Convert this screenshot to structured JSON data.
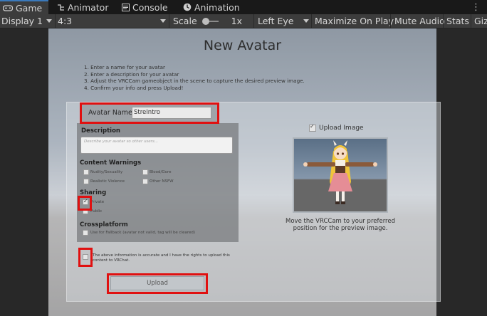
{
  "tabs": [
    {
      "label": "Game",
      "icon": "gamepad-icon",
      "active": true
    },
    {
      "label": "Animator",
      "icon": "animator-icon",
      "active": false
    },
    {
      "label": "Console",
      "icon": "console-icon",
      "active": false
    },
    {
      "label": "Animation",
      "icon": "animation-clock-icon",
      "active": false
    }
  ],
  "toolbar": {
    "display": "Display 1",
    "aspect": "4:3",
    "scale_label": "Scale",
    "scale_value": "1x",
    "eye": "Left Eye",
    "maximize": "Maximize On Play",
    "mute": "Mute Audio",
    "stats": "Stats",
    "gizmos": "Giz"
  },
  "avatar_form": {
    "title": "New Avatar",
    "instructions": [
      "1. Enter a name for your avatar",
      "2. Enter a description for your avatar",
      "3. Adjust the VRCCam gameobject in the scene to capture the desired preview image.",
      "4. Confirm your info and press Upload!"
    ],
    "name_label": "Avatar Name",
    "name_value": "StreIntro",
    "description_label": "Description",
    "description_placeholder": "Describe your avatar so other users...",
    "content_warnings_label": "Content Warnings",
    "warnings": [
      {
        "label": "Nudity/Sexuality",
        "checked": false
      },
      {
        "label": "Blood/Gore",
        "checked": false
      },
      {
        "label": "Realistic Violence",
        "checked": false
      },
      {
        "label": "Other NSFW",
        "checked": false
      }
    ],
    "sharing_label": "Sharing",
    "sharing_options": [
      {
        "label": "Private",
        "checked": true
      },
      {
        "label": "Public",
        "checked": false
      }
    ],
    "crossplatform_label": "Crossplatform",
    "crossplatform_option": "Use for Fallback (avatar not valid, tag will be cleared)",
    "upload_image_label": "Upload Image",
    "upload_image_checked": true,
    "preview_caption": "Move the VRCCam to your preferred position for the preview image.",
    "agreement_text": "The above information is accurate and I have the rights to upload this content to VRChat.",
    "agreement_checked": false,
    "upload_button": "Upload"
  },
  "colors": {
    "highlight": "#e01010",
    "tab_accent": "#3a79bb"
  }
}
